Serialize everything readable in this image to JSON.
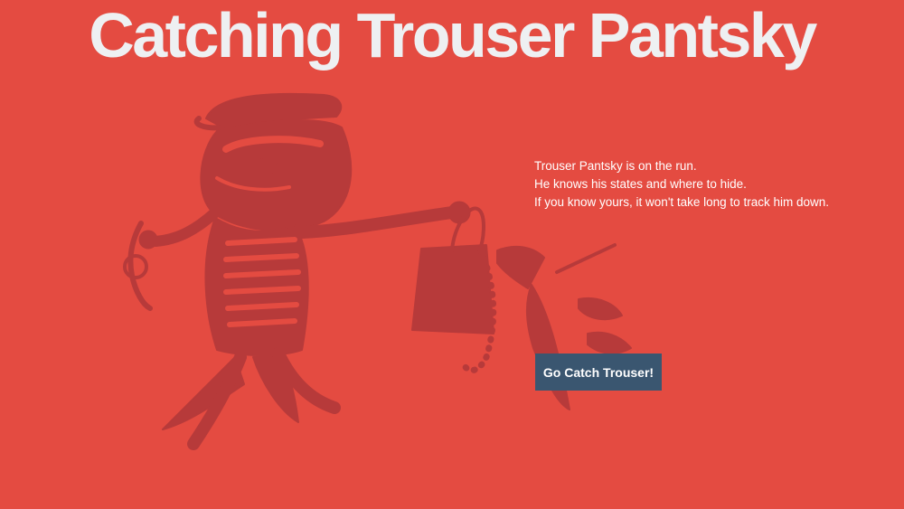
{
  "page": {
    "title": "Catching Trouser Pantsky",
    "intro_lines": [
      "Trouser Pantsky is on the run.",
      "He knows his states and where to hide.",
      "If you know yours, it won't take long to track him down."
    ],
    "cta_label": "Go Catch Trouser!"
  },
  "illustration": {
    "icon": "burglar-illustration"
  },
  "colors": {
    "background": "#e44b41",
    "title": "#eef0f2",
    "illustration": "#b73a3a",
    "button": "#3a5670",
    "text": "#ffffff"
  }
}
